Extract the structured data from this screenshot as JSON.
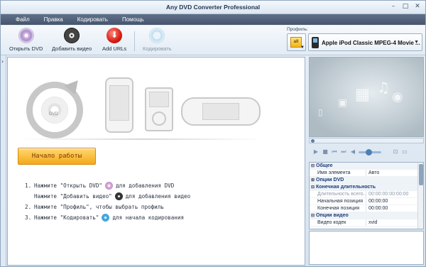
{
  "window": {
    "title": "Any DVD Converter Professional"
  },
  "menu": [
    "Файл",
    "Правка",
    "Кодировать",
    "Помощь"
  ],
  "toolbar": {
    "open_dvd": "Открыть DVD",
    "add_video": "Добавить видео",
    "add_urls": "Add URLs",
    "encode": "Кодировать",
    "profile_label": "Профиль:",
    "profile_all": "all",
    "profile_value": "Apple iPod Classic MPEG-4 Movie ..."
  },
  "main": {
    "dvd_label": "DVD",
    "start_button": "Начало работы",
    "steps": [
      {
        "num": "1.",
        "before": "Нажмите \"Открыть DVD\"",
        "icon": "dvd-icon",
        "after": "для добавления DVD"
      },
      {
        "num": "",
        "before": "Нажмите \"Добавить видео\"",
        "icon": "film-icon",
        "after": "для добавления видео"
      },
      {
        "num": "2.",
        "before": "Нажмите \"Профиль\", чтобы выбрать профиль",
        "icon": "",
        "after": ""
      },
      {
        "num": "3.",
        "before": "Нажмите \"Кодировать\"",
        "icon": "encode-icon",
        "after": "для начала кодирования"
      }
    ]
  },
  "properties": [
    {
      "type": "cat",
      "label": "Общее",
      "toggle": "⊟"
    },
    {
      "type": "row",
      "key": "Имя элемента",
      "value": "Авто"
    },
    {
      "type": "cat",
      "label": "Опции DVD",
      "toggle": "⊞"
    },
    {
      "type": "cat",
      "label": "Конечная длительность",
      "toggle": "⊟"
    },
    {
      "type": "row",
      "muted": true,
      "key": "Длительность всего...",
      "value": "00:00:00:00:00:00"
    },
    {
      "type": "row",
      "key": "Начальная позиция",
      "value": "00:00:00"
    },
    {
      "type": "row",
      "key": "Конечная позиция",
      "value": "00:00:00"
    },
    {
      "type": "cat",
      "label": "Опции видео",
      "toggle": "⊟"
    },
    {
      "type": "row",
      "key": "Видео кодек",
      "value": "xvid"
    }
  ],
  "player": {
    "buttons": [
      "▶",
      "■",
      "⏮",
      "⏭",
      "◀"
    ]
  },
  "colors": {
    "menubar": "#4f5e76",
    "start_button": "#f4a91a",
    "category_text": "#1c3b76"
  }
}
